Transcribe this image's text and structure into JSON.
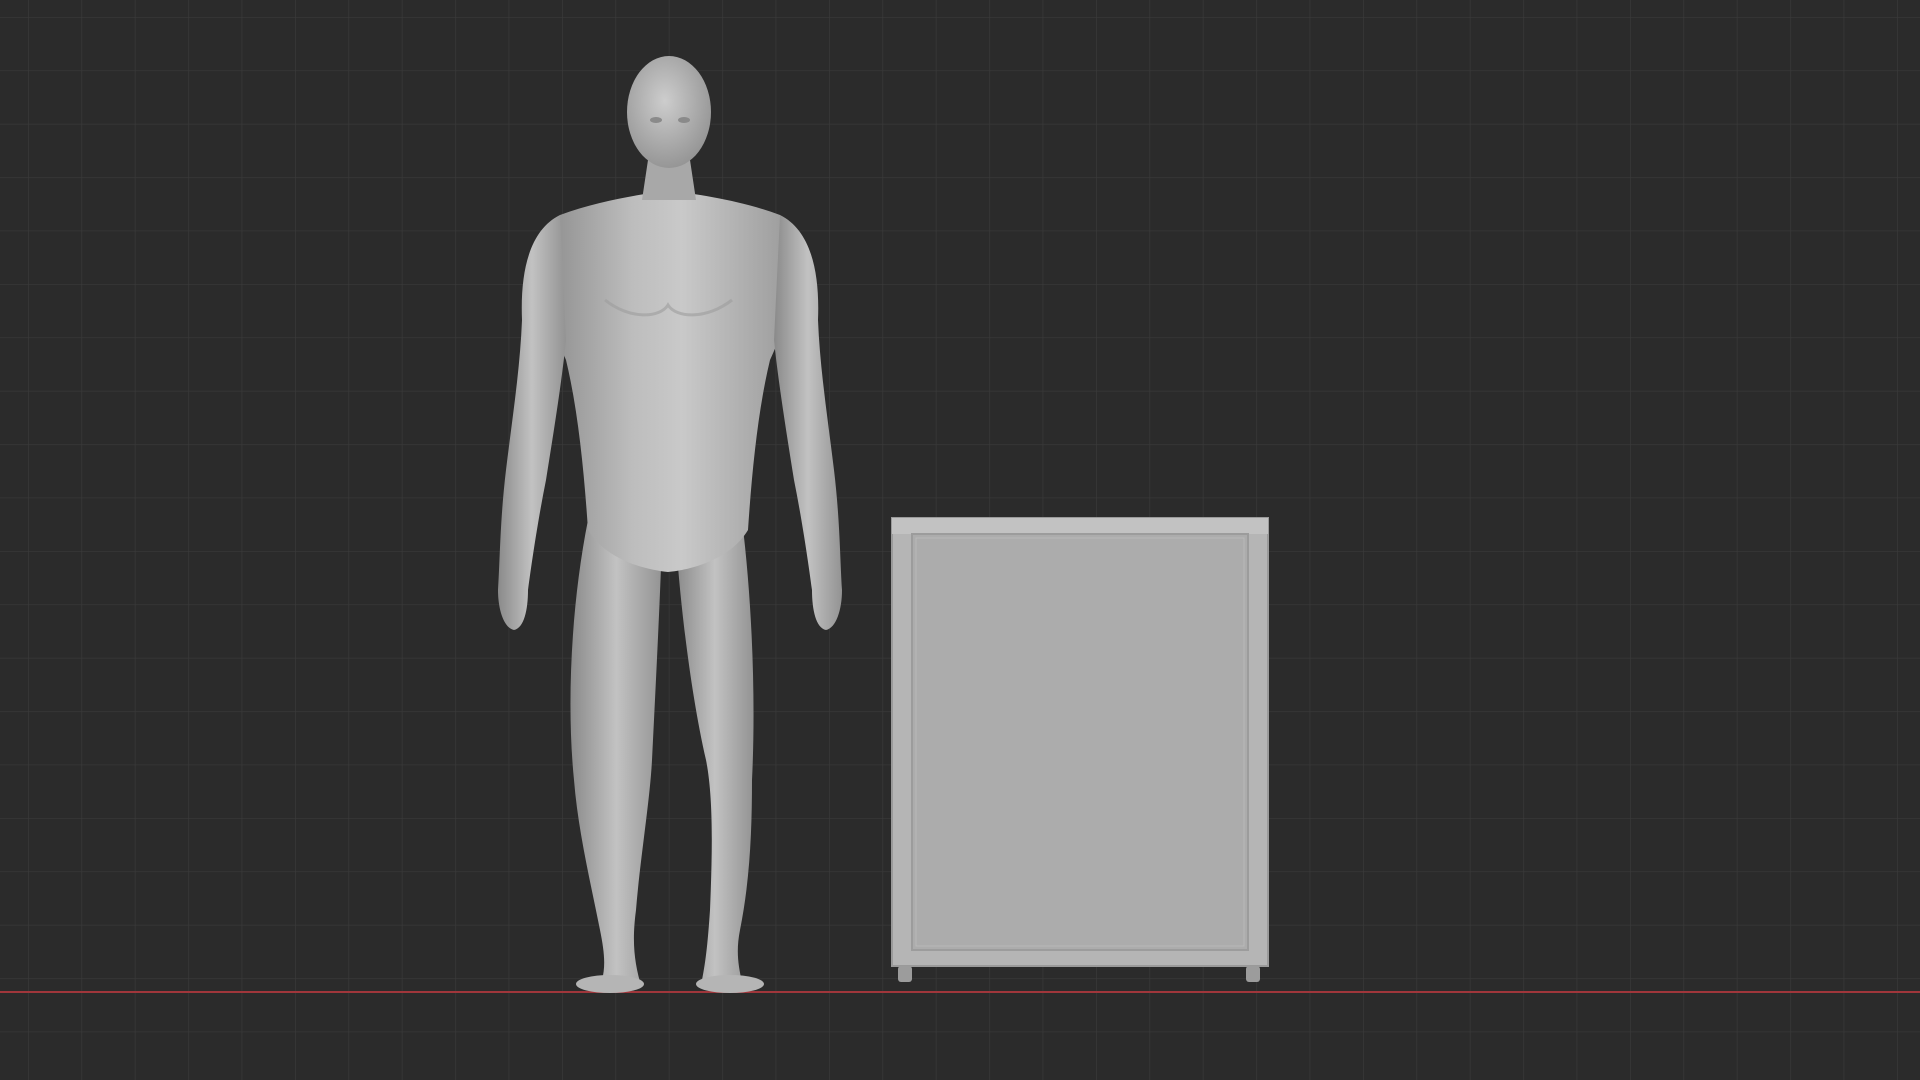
{
  "viewport": {
    "view": "front-orthographic",
    "shading": "solid",
    "colors": {
      "background": "#2b2b2b",
      "grid_line": "#3a3a3a",
      "x_axis": "#a0363b",
      "mesh_light": "#c6c6c6",
      "mesh_mid": "#a9a9a9",
      "mesh_dark": "#7f7f7f"
    },
    "objects": [
      {
        "name": "human-figure",
        "kind": "base-mesh"
      },
      {
        "name": "cabinet",
        "kind": "box-with-panel"
      }
    ]
  }
}
